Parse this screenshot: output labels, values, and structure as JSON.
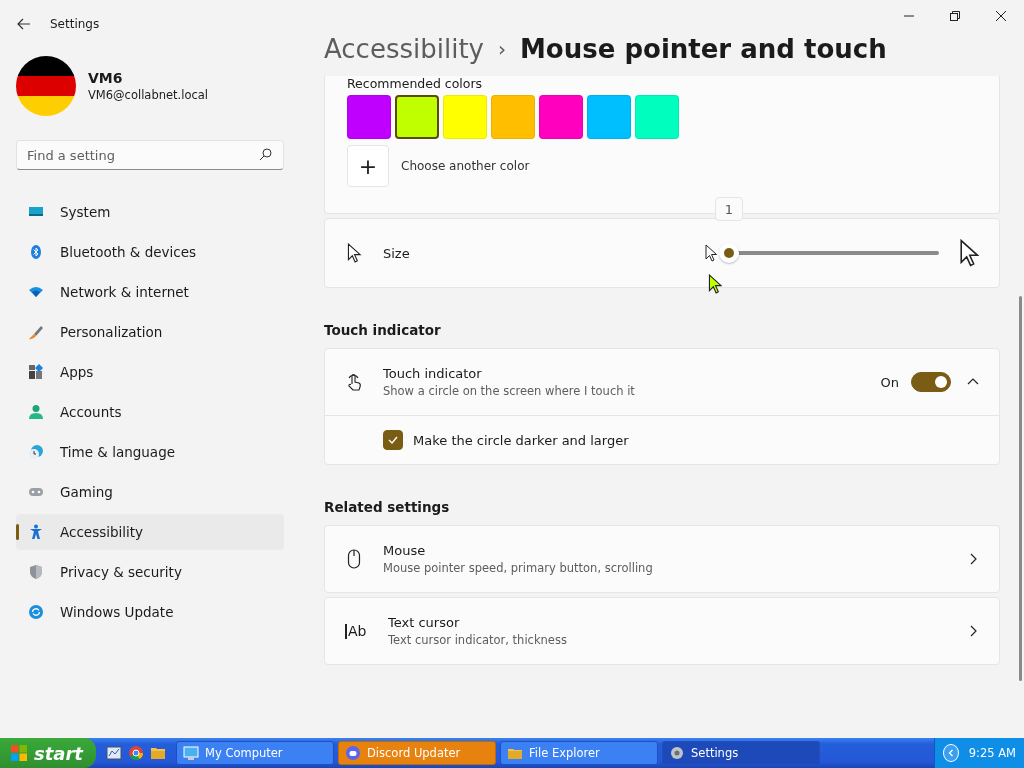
{
  "window": {
    "title": "Settings"
  },
  "user": {
    "name": "VM6",
    "email": "VM6@collabnet.local"
  },
  "search": {
    "placeholder": "Find a setting"
  },
  "sidebar": {
    "items": [
      {
        "label": "System",
        "selected": false
      },
      {
        "label": "Bluetooth & devices",
        "selected": false
      },
      {
        "label": "Network & internet",
        "selected": false
      },
      {
        "label": "Personalization",
        "selected": false
      },
      {
        "label": "Apps",
        "selected": false
      },
      {
        "label": "Accounts",
        "selected": false
      },
      {
        "label": "Time & language",
        "selected": false
      },
      {
        "label": "Gaming",
        "selected": false
      },
      {
        "label": "Accessibility",
        "selected": true
      },
      {
        "label": "Privacy & security",
        "selected": false
      },
      {
        "label": "Windows Update",
        "selected": false
      }
    ]
  },
  "breadcrumb": {
    "parent": "Accessibility",
    "separator": "›",
    "current": "Mouse pointer and touch"
  },
  "colors": {
    "title": "Recommended colors",
    "swatches": [
      {
        "color": "#c000ff",
        "selected": false
      },
      {
        "color": "#bfff00",
        "selected": true
      },
      {
        "color": "#ffff00",
        "selected": false
      },
      {
        "color": "#ffbf00",
        "selected": false
      },
      {
        "color": "#ff00bf",
        "selected": false
      },
      {
        "color": "#00bfff",
        "selected": false
      },
      {
        "color": "#00ffbf",
        "selected": false
      }
    ],
    "add_symbol": "+",
    "add_label": "Choose another color"
  },
  "size": {
    "label": "Size",
    "value": "1",
    "level": 0
  },
  "touch": {
    "heading": "Touch indicator",
    "title": "Touch indicator",
    "description": "Show a circle on the screen where I touch it",
    "state_label": "On",
    "on": true,
    "expanded": true,
    "option": {
      "label": "Make the circle darker and larger",
      "checked": true
    }
  },
  "related": {
    "heading": "Related settings",
    "items": [
      {
        "kind": "mouse",
        "title": "Mouse",
        "description": "Mouse pointer speed, primary button, scrolling"
      },
      {
        "kind": "text-cursor",
        "icon_text": "Ab",
        "title": "Text cursor",
        "description": "Text cursor indicator, thickness"
      }
    ]
  },
  "taskbar": {
    "start": "start",
    "tasks": [
      {
        "label": "My Computer",
        "selected": false,
        "flashing": false
      },
      {
        "label": "Discord Updater",
        "selected": false,
        "flashing": true
      },
      {
        "label": "File Explorer",
        "selected": false,
        "flashing": false
      },
      {
        "label": "Settings",
        "selected": true,
        "flashing": false
      }
    ],
    "time": "9:25 AM"
  }
}
